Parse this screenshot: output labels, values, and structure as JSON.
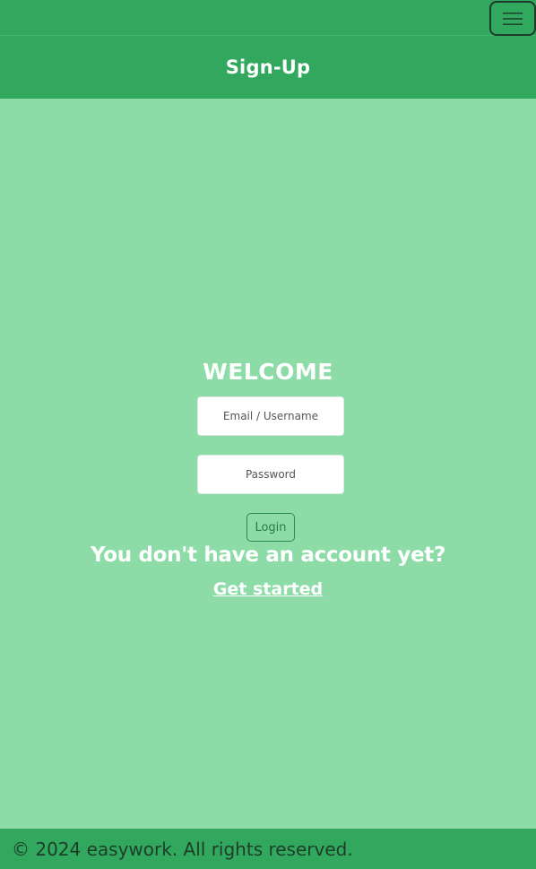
{
  "nav": {
    "menu_icon": "hamburger-menu-icon"
  },
  "header": {
    "title": "Sign-Up"
  },
  "login_form": {
    "heading": "WELCOME",
    "email_placeholder": "Email / Username",
    "email_value": "",
    "password_placeholder": "Password",
    "password_value": "",
    "login_label": "Login"
  },
  "signup_prompt": {
    "text": "You don't have an account yet?",
    "link_label": "Get started"
  },
  "footer": {
    "copyright": "© 2024 easywork. All rights reserved."
  },
  "colors": {
    "primary_green": "#31a85e",
    "background_green": "#8ddca8",
    "text_white": "#ffffff"
  }
}
